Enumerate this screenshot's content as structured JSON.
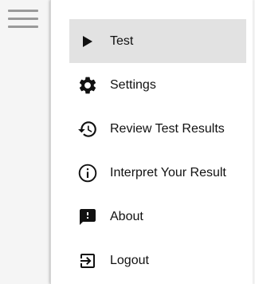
{
  "menu": {
    "items": [
      {
        "label": "Test",
        "icon": "play-icon",
        "active": true
      },
      {
        "label": "Settings",
        "icon": "gear-icon",
        "active": false
      },
      {
        "label": "Review Test Results",
        "icon": "history-icon",
        "active": false
      },
      {
        "label": "Interpret Your Result",
        "icon": "info-icon",
        "active": false
      },
      {
        "label": "About",
        "icon": "feedback-icon",
        "active": false
      },
      {
        "label": "Logout",
        "icon": "logout-icon",
        "active": false
      }
    ]
  },
  "colors": {
    "active_background": "#e2e2e2",
    "icon": "#111111",
    "hamburger": "#9a9a9a"
  }
}
